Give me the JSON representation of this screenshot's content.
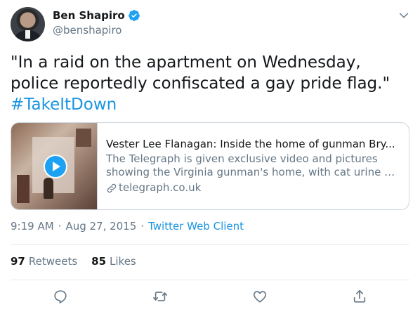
{
  "author": {
    "display_name": "Ben Shapiro",
    "handle": "@benshapiro",
    "verified": true
  },
  "tweet": {
    "text": "\"In a raid on the apartment on Wednesday, police reportedly confiscated a gay pride flag.\"",
    "hashtag": "#TakeItDown"
  },
  "card": {
    "title": "Vester Lee Flanagan: Inside the home of gunman Bry...",
    "description_line1": "The Telegraph is given exclusive video and pictures",
    "description_line2": "showing the Virginia gunman's home, with cat urine a...",
    "domain": "telegraph.co.uk"
  },
  "meta": {
    "time": "9:19 AM",
    "date": "Aug 27, 2015",
    "separator": "·",
    "client": "Twitter Web Client"
  },
  "stats": {
    "retweets_count": "97",
    "retweets_label": "Retweets",
    "likes_count": "85",
    "likes_label": "Likes"
  },
  "icons": {
    "verified": "verified-badge-icon",
    "menu": "chevron-down-icon",
    "reply": "reply-icon",
    "retweet": "retweet-icon",
    "like": "heart-icon",
    "share": "share-icon",
    "link": "link-icon",
    "play": "play-icon"
  },
  "colors": {
    "accent": "#1b95e0",
    "text_primary": "#14171a",
    "text_secondary": "#657786",
    "border": "#ccd6dd"
  }
}
